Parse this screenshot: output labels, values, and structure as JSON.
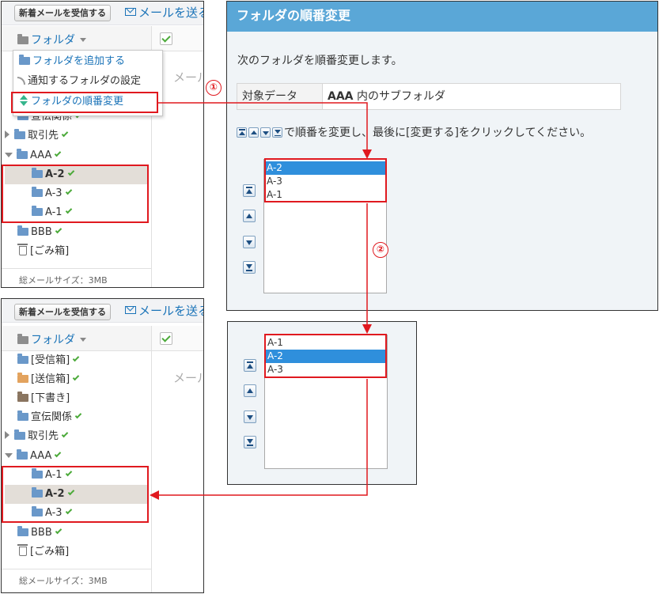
{
  "top_pane": {
    "receive_button": "新着メールを受信する",
    "send_link": "メールを送る",
    "folder_header": "フォルダ",
    "mail_placeholder": "メール",
    "footer": "総メールサイズ：3MB",
    "dropdown": {
      "add_folder": "フォルダを追加する",
      "notify_settings": "通知するフォルダの設定",
      "reorder": "フォルダの順番変更"
    },
    "tree": {
      "senden": "宣伝関係",
      "torihikisaki": "取引先",
      "aaa": "AAA",
      "a2": "A-2",
      "a3": "A-3",
      "a1": "A-1",
      "bbb": "BBB",
      "trash": "[ごみ箱]"
    }
  },
  "bottom_pane": {
    "receive_button": "新着メールを受信する",
    "send_link": "メールを送る",
    "folder_header": "フォルダ",
    "mail_placeholder": "メール",
    "footer": "総メールサイズ：3MB",
    "tree": {
      "inbox": "[受信箱]",
      "sent": "[送信箱]",
      "drafts": "[下書き]",
      "senden": "宣伝関係",
      "torihikisaki": "取引先",
      "aaa": "AAA",
      "a1": "A-1",
      "a2": "A-2",
      "a3": "A-3",
      "bbb": "BBB",
      "trash": "[ごみ箱]"
    }
  },
  "dialog": {
    "title": "フォルダの順番変更",
    "description": "次のフォルダを順番変更します。",
    "target_label": "対象データ",
    "target_value_bold": "AAA",
    "target_value_rest": " 内のサブフォルダ",
    "instruction": "で順番を変更し、最後に[変更する]をクリックしてください。",
    "list_before": [
      "A-2",
      "A-3",
      "A-1"
    ],
    "list_after": [
      "A-1",
      "A-2",
      "A-3"
    ]
  },
  "annotations": {
    "step1": "①",
    "step2": "②",
    "accent_color": "#e0191f"
  }
}
